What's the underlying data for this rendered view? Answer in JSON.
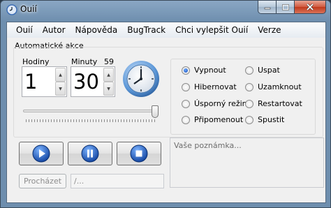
{
  "window": {
    "title": "Ouií"
  },
  "menu": [
    "Ouií",
    "Autor",
    "Nápověda",
    "BugTrack",
    "Chci vylepšit Ouií",
    "Verze"
  ],
  "group": {
    "title": "Automatické akce"
  },
  "hours": {
    "label": "Hodiny",
    "value": "1"
  },
  "minutes": {
    "label": "Minuty",
    "value": "30",
    "counter": "59"
  },
  "slider": {
    "value": 1.0
  },
  "actions": [
    {
      "label": "Vypnout",
      "selected": true
    },
    {
      "label": "Hibernovat",
      "selected": false
    },
    {
      "label": "Úsporný režim",
      "selected": false
    },
    {
      "label": "Připomenout",
      "selected": false
    },
    {
      "label": "Uspat",
      "selected": false
    },
    {
      "label": "Uzamknout",
      "selected": false
    },
    {
      "label": "Restartovat",
      "selected": false
    },
    {
      "label": "Spustit",
      "selected": false
    }
  ],
  "controls": {
    "play_icon": "play-icon",
    "pause_icon": "pause-icon",
    "stop_icon": "stop-icon"
  },
  "browse": {
    "label": "Procházet",
    "path": "/..."
  },
  "note": {
    "placeholder": "Vaše poznámka..."
  },
  "colors": {
    "accent": "#1c5bbf",
    "title_bar": "#6e8eae"
  }
}
